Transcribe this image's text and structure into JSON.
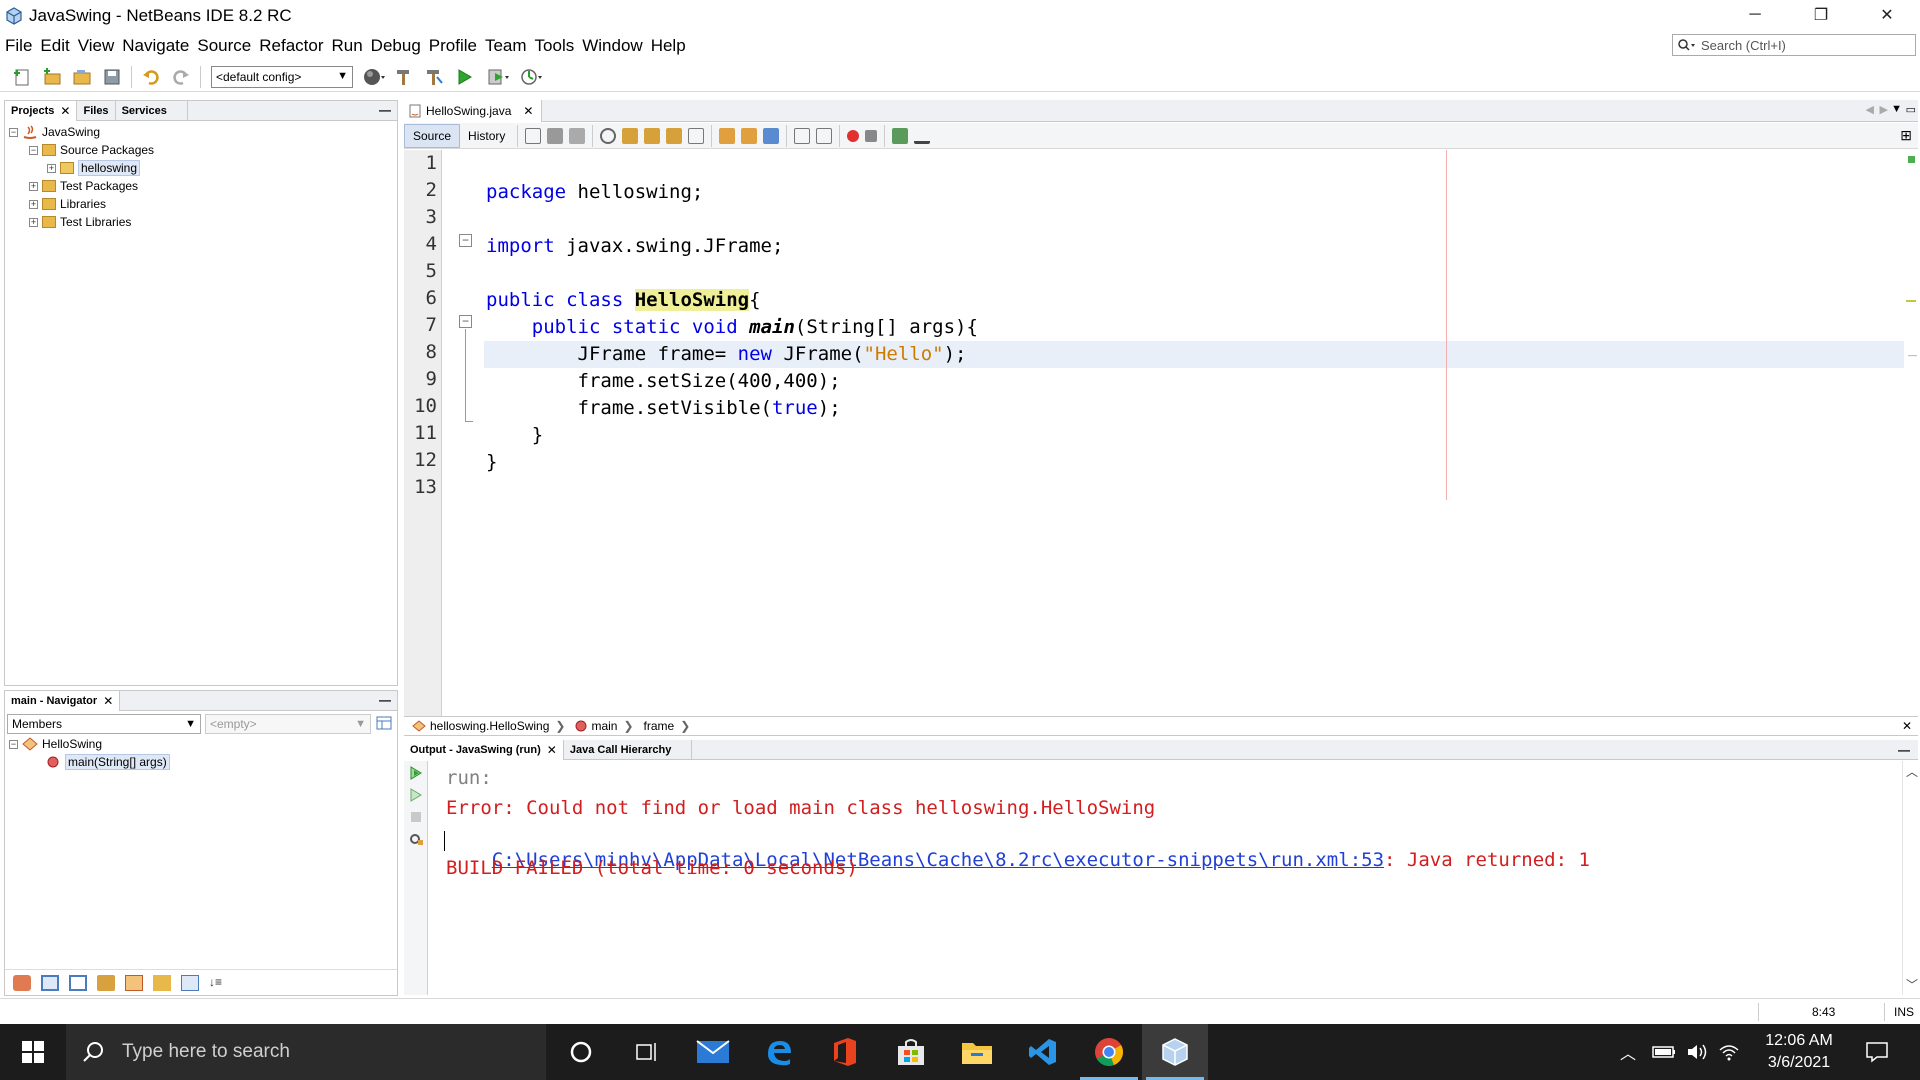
{
  "window": {
    "title": "JavaSwing - NetBeans IDE 8.2 RC",
    "controls": [
      "─",
      "❐",
      "✕"
    ]
  },
  "menu": [
    "File",
    "Edit",
    "View",
    "Navigate",
    "Source",
    "Refactor",
    "Run",
    "Debug",
    "Profile",
    "Team",
    "Tools",
    "Window",
    "Help"
  ],
  "search": {
    "placeholder": "Search (Ctrl+I)"
  },
  "toolbar": {
    "config": "<default config>"
  },
  "projects_panel": {
    "tabs": [
      "Projects",
      "Files",
      "Services"
    ],
    "tree": [
      {
        "label": "JavaSwing",
        "level": 0,
        "toggle": "−"
      },
      {
        "label": "Source Packages",
        "level": 1,
        "toggle": "−"
      },
      {
        "label": "helloswing",
        "level": 2,
        "toggle": "+"
      },
      {
        "label": "Test Packages",
        "level": 1,
        "toggle": "+"
      },
      {
        "label": "Libraries",
        "level": 1,
        "toggle": "+"
      },
      {
        "label": "Test Libraries",
        "level": 1,
        "toggle": "+"
      }
    ]
  },
  "navigator_panel": {
    "title": "main - Navigator",
    "members_label": "Members",
    "filter_placeholder": "<empty>",
    "tree": [
      {
        "label": "HelloSwing"
      },
      {
        "label": "main(String[] args)"
      }
    ]
  },
  "editor": {
    "file_tab": "HelloSwing.java",
    "source_tab": "Source",
    "history_tab": "History",
    "line_numbers": [
      "1",
      "2",
      "3",
      "4",
      "5",
      "6",
      "7",
      "8",
      "9",
      "10",
      "11",
      "12",
      "13"
    ],
    "code": {
      "l2_kw": "package",
      "l2_rest": " helloswing;",
      "l4_kw": "import",
      "l4_rest": " javax.swing.JFrame;",
      "l6_kw": "public class",
      "l6_cls": "HelloSwing",
      "l6_rest": "{",
      "l7_indent": "    ",
      "l7_kw": "public static void",
      "l7_mth": "main",
      "l7_rest": "(String[] args){",
      "l8_pre": "        JFrame frame= ",
      "l8_kw": "new",
      "l8_mid": " JFrame(",
      "l8_str": "\"Hello\"",
      "l8_end": ");",
      "l9": "        frame.setSize(400,400);",
      "l10_pre": "        frame.setVisible(",
      "l10_kw": "true",
      "l10_end": ");",
      "l11": "    }",
      "l12": "}"
    }
  },
  "breadcrumb": [
    "helloswing.HelloSwing",
    "main",
    "frame"
  ],
  "output": {
    "tabs": [
      "Output - JavaSwing (run)",
      "Java Call Hierarchy"
    ],
    "lines": {
      "run": "run:",
      "error": "Error: Could not find or load main class helloswing.HelloSwing",
      "link": "C:\\Users\\minhv\\AppData\\Local\\NetBeans\\Cache\\8.2rc\\executor-snippets\\run.xml:53",
      "link_rest": ": Java returned: 1",
      "failed": "BUILD FAILED (total time: 0 seconds)"
    }
  },
  "status": {
    "position": "8:43",
    "mode": "INS"
  },
  "taskbar": {
    "search_placeholder": "Type here to search",
    "time": "12:06 AM",
    "date": "3/6/2021"
  }
}
